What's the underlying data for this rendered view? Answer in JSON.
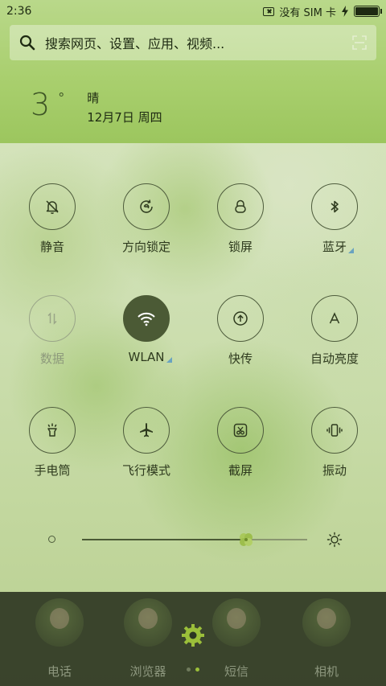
{
  "status_bar": {
    "time": "2:36",
    "sim_status": "没有 SIM 卡",
    "charging_icon": "bolt-icon",
    "battery_level": 1.0
  },
  "search": {
    "placeholder": "搜索网页、设置、应用、视频..."
  },
  "weather": {
    "temperature": "3",
    "degree": "°",
    "condition": "晴",
    "date": "12月7日 周四"
  },
  "toggles": [
    {
      "label": "静音",
      "icon": "bell-off-icon",
      "state": "off"
    },
    {
      "label": "方向锁定",
      "icon": "rotation-lock-icon",
      "state": "off"
    },
    {
      "label": "锁屏",
      "icon": "lock-icon",
      "state": "off"
    },
    {
      "label": "蓝牙",
      "icon": "bluetooth-icon",
      "state": "off",
      "has_settings": true
    },
    {
      "label": "数据",
      "icon": "mobile-data-icon",
      "state": "disabled"
    },
    {
      "label": "WLAN",
      "icon": "wifi-icon",
      "state": "on",
      "has_settings": true
    },
    {
      "label": "快传",
      "icon": "quick-transfer-icon",
      "state": "off"
    },
    {
      "label": "自动亮度",
      "icon": "auto-brightness-icon",
      "state": "off"
    },
    {
      "label": "手电筒",
      "icon": "flashlight-icon",
      "state": "off"
    },
    {
      "label": "飞行模式",
      "icon": "airplane-icon",
      "state": "off"
    },
    {
      "label": "截屏",
      "icon": "screenshot-icon",
      "state": "off"
    },
    {
      "label": "振动",
      "icon": "vibrate-icon",
      "state": "off"
    }
  ],
  "brightness": {
    "level": 0.73
  },
  "dock": {
    "items": [
      {
        "label": "电话",
        "icon": "phone-app-icon"
      },
      {
        "label": "浏览器",
        "icon": "browser-app-icon"
      },
      {
        "label": "短信",
        "icon": "messages-app-icon"
      },
      {
        "label": "相机",
        "icon": "camera-app-icon"
      }
    ],
    "center_icon": "gear-icon",
    "pages": 2,
    "current_page": 2
  },
  "colors": {
    "accent_active": "#4b5a35",
    "settings_indicator": "#6aa3c0",
    "page_dot_active": "#9bbf3a"
  }
}
